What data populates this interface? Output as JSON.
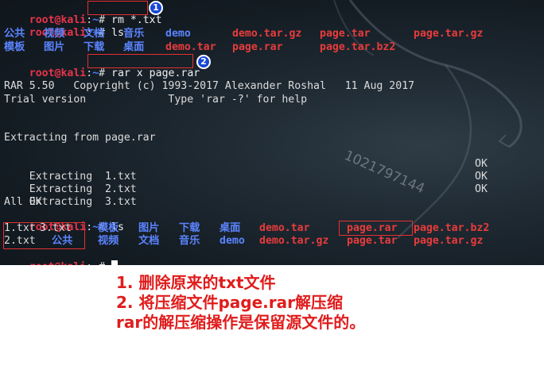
{
  "prompt": {
    "user": "root@kali",
    "sep": ":",
    "dir": "~",
    "hash": "#"
  },
  "commands": {
    "rm": "rm *.txt",
    "ls1": "ls",
    "rar": "rar x page.rar",
    "ls2": "ls"
  },
  "ls1_rows": [
    [
      {
        "text": "公共",
        "kind": "dir"
      },
      {
        "text": "视频",
        "kind": "dir"
      },
      {
        "text": "文档",
        "kind": "dir"
      },
      {
        "text": "音乐",
        "kind": "dir"
      },
      {
        "text": "demo",
        "kind": "dir"
      },
      {
        "text": "demo.tar.gz",
        "kind": "arc"
      },
      {
        "text": "page.tar",
        "kind": "arc"
      },
      {
        "text": "page.tar.gz",
        "kind": "arc"
      }
    ],
    [
      {
        "text": "模板",
        "kind": "dir"
      },
      {
        "text": "图片",
        "kind": "dir"
      },
      {
        "text": "下载",
        "kind": "dir"
      },
      {
        "text": "桌面",
        "kind": "dir"
      },
      {
        "text": "demo.tar",
        "kind": "arc"
      },
      {
        "text": "page.rar",
        "kind": "arc"
      },
      {
        "text": "page.tar.bz2",
        "kind": "arc"
      }
    ]
  ],
  "rar_output": {
    "banner": "RAR 5.50   Copyright (c) 1993-2017 Alexander Roshal   11 Aug 2017",
    "trial": "Trial version             Type 'rar -?' for help",
    "extracting_from": "Extracting from page.rar",
    "files": [
      {
        "label": "Extracting  1.txt",
        "status": "OK"
      },
      {
        "label": "Extracting  2.txt",
        "status": "OK"
      },
      {
        "label": "Extracting  3.txt",
        "status": "OK"
      }
    ],
    "all_ok": "All OK"
  },
  "ls2_rows": [
    [
      {
        "text": "1.txt",
        "kind": "plain"
      },
      {
        "text": "3.txt",
        "kind": "plain"
      },
      {
        "text": "模板",
        "kind": "dir"
      },
      {
        "text": "图片",
        "kind": "dir"
      },
      {
        "text": "下载",
        "kind": "dir"
      },
      {
        "text": "桌面",
        "kind": "dir"
      },
      {
        "text": "demo.tar",
        "kind": "arc"
      },
      {
        "text": "page.rar",
        "kind": "arc"
      },
      {
        "text": "page.tar.bz2",
        "kind": "arc"
      }
    ],
    [
      {
        "text": "2.txt",
        "kind": "plain"
      },
      {
        "text": "公共",
        "kind": "dir"
      },
      {
        "text": "视频",
        "kind": "dir"
      },
      {
        "text": "文档",
        "kind": "dir"
      },
      {
        "text": "音乐",
        "kind": "dir"
      },
      {
        "text": "demo",
        "kind": "dir"
      },
      {
        "text": "demo.tar.gz",
        "kind": "arc"
      },
      {
        "text": "page.tar",
        "kind": "arc"
      },
      {
        "text": "page.tar.gz",
        "kind": "arc"
      }
    ]
  ],
  "badges": {
    "one": "1",
    "two": "2"
  },
  "watermark": "1021797144",
  "notes": [
    "1. 删除原来的txt文件",
    "2. 将压缩文件page.rar解压缩",
    "rar的解压缩操作是保留源文件的。"
  ],
  "colors": {
    "prompt_user": "#e8344a",
    "prompt_dir": "#4a7cff",
    "dir": "#5b84ff",
    "archive": "#e83c3c",
    "annotation": "#e01c1c",
    "badge": "#1747d6"
  }
}
